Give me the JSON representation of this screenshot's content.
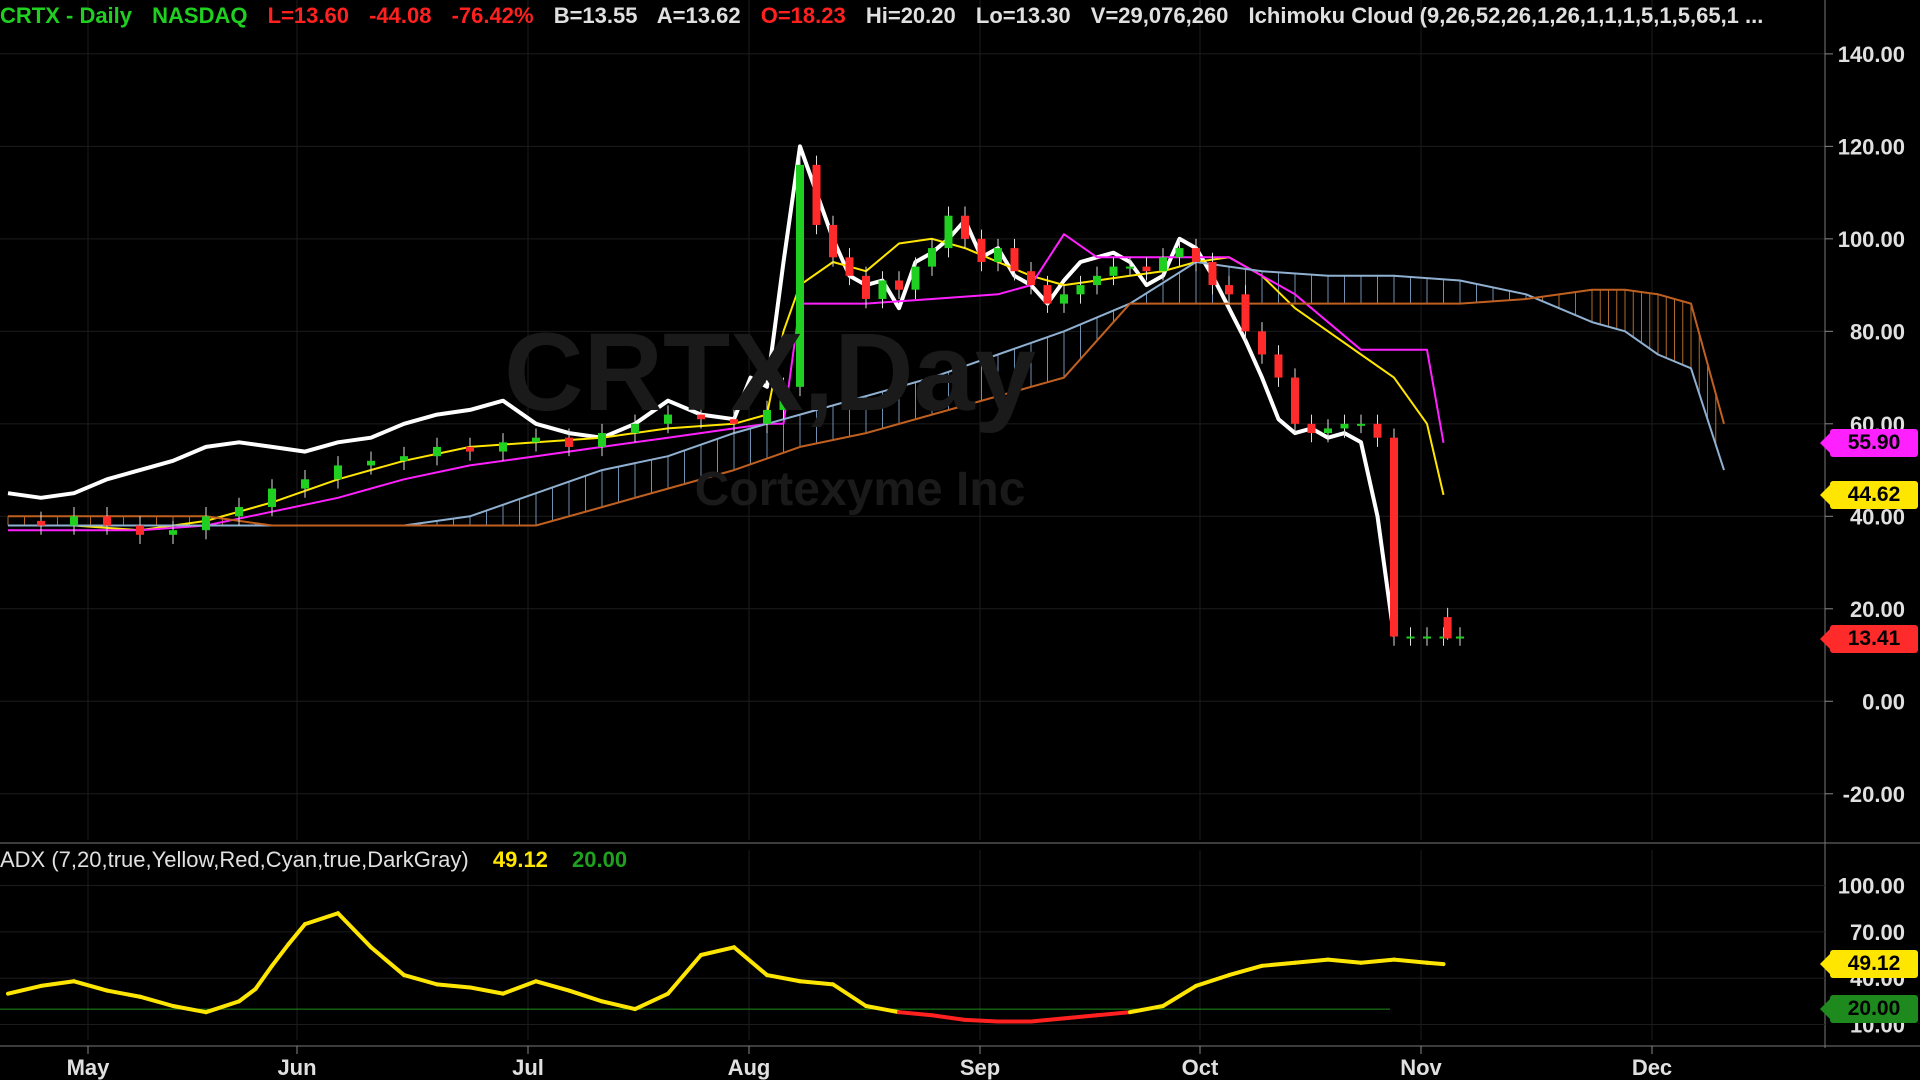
{
  "header": {
    "symbol": "CRTX - Daily",
    "exchange": "NASDAQ",
    "last": "L=13.60",
    "change": "-44.08",
    "change_pct": "-76.42%",
    "bid": "B=13.55",
    "ask": "A=13.62",
    "open": "O=18.23",
    "high": "Hi=20.20",
    "low": "Lo=13.30",
    "volume": "V=29,076,260",
    "study": "Ichimoku Cloud (9,26,52,26,1,26,1,1,1,5,1,5,65,1 ..."
  },
  "watermark": {
    "symbol": "CRTX,Day",
    "company": "Cortexyme Inc"
  },
  "adx_header": {
    "label": "ADX (7,20,true,Yellow,Red,Cyan,true,DarkGray)",
    "value": "49.12",
    "threshold": "20.00"
  },
  "price_tags": [
    {
      "value": "55.90",
      "color": "#ff20ff",
      "text_color": "#000"
    },
    {
      "value": "44.62",
      "color": "#ffe600",
      "text_color": "#000"
    },
    {
      "value": "13.41",
      "color": "#ff2a2a",
      "text_color": "#000"
    }
  ],
  "adx_tags": [
    {
      "value": "49.12",
      "color": "#ffe600",
      "text_color": "#000"
    },
    {
      "value": "20.00",
      "color": "#1e8a1e",
      "text_color": "#000"
    }
  ],
  "chart_data": [
    {
      "type": "line",
      "title": "CRTX - Daily",
      "x_labels": [
        "May",
        "Jun",
        "Jul",
        "Aug",
        "Sep",
        "Oct",
        "Nov",
        "Dec"
      ],
      "y_ticks": [
        "140.00",
        "120.00",
        "100.00",
        "80.00",
        "60.00",
        "40.00",
        "20.00",
        "0.00",
        "-20.00"
      ],
      "ylim": [
        -30,
        143
      ],
      "series": [
        {
          "name": "lagging",
          "color": "#ffffff",
          "x": [
            0,
            4,
            8,
            12,
            16,
            20,
            24,
            28,
            32,
            36,
            40,
            44,
            48,
            52,
            56,
            60,
            64,
            68,
            72,
            76,
            80,
            84,
            88,
            90,
            92,
            94,
            96,
            98,
            100,
            102,
            104,
            106,
            108,
            110,
            112,
            114,
            116,
            118,
            120,
            122,
            124,
            126,
            128,
            130,
            132,
            134,
            136,
            138,
            140,
            142,
            144,
            146,
            148,
            150,
            152,
            154,
            156,
            158,
            160,
            162,
            164,
            166,
            168,
            170,
            172,
            174,
            176
          ],
          "y": [
            45,
            44,
            45,
            48,
            50,
            52,
            55,
            56,
            55,
            54,
            56,
            57,
            60,
            62,
            63,
            65,
            60,
            58,
            57,
            60,
            65,
            62,
            61,
            70,
            68,
            95,
            120,
            110,
            100,
            92,
            90,
            91,
            85,
            95,
            97,
            100,
            104,
            96,
            98,
            92,
            90,
            86,
            91,
            95,
            96,
            97,
            95,
            90,
            92,
            100,
            98,
            92,
            85,
            78,
            70,
            61,
            58,
            59,
            57,
            58,
            56,
            40,
            14,
            null,
            null,
            null,
            null
          ]
        },
        {
          "name": "price-close",
          "color": "#20d020",
          "x": [
            0,
            4,
            8,
            12,
            16,
            20,
            24,
            28,
            32,
            36,
            40,
            44,
            48,
            52,
            56,
            60,
            64,
            68,
            72,
            76,
            80,
            84,
            88,
            92,
            94,
            96,
            98,
            100,
            102,
            104,
            106,
            108,
            110,
            112,
            114,
            116,
            118,
            120,
            122,
            124,
            126,
            128,
            130,
            132,
            134,
            136,
            138,
            140,
            142,
            144,
            146,
            148,
            150,
            152,
            154,
            156,
            158,
            160,
            162,
            164,
            166,
            168,
            170,
            172,
            174,
            176
          ],
          "y": [
            39,
            38,
            40,
            38,
            36,
            37,
            40,
            42,
            46,
            48,
            51,
            52,
            53,
            55,
            54,
            56,
            57,
            55,
            58,
            60,
            62,
            61,
            60,
            63,
            68,
            116,
            103,
            96,
            92,
            87,
            91,
            89,
            94,
            98,
            105,
            100,
            95,
            98,
            93,
            90,
            86,
            88,
            90,
            92,
            94,
            94,
            93,
            96,
            98,
            95,
            90,
            88,
            80,
            75,
            70,
            60,
            58,
            59,
            60,
            60,
            57,
            14,
            14,
            14,
            14,
            14
          ]
        },
        {
          "name": "tenkan",
          "color": "#ffe600",
          "x": [
            0,
            8,
            16,
            24,
            32,
            40,
            48,
            56,
            64,
            72,
            80,
            88,
            92,
            94,
            96,
            100,
            104,
            108,
            112,
            116,
            120,
            124,
            128,
            132,
            136,
            140,
            144,
            148,
            152,
            156,
            160,
            164,
            168,
            172,
            174
          ],
          "y": [
            38,
            38,
            37,
            39,
            43,
            48,
            52,
            55,
            56,
            57,
            59,
            60,
            62,
            80,
            90,
            95,
            93,
            99,
            100,
            98,
            95,
            92,
            90,
            91,
            92,
            93,
            95,
            96,
            92,
            85,
            80,
            75,
            70,
            60,
            44.62
          ]
        },
        {
          "name": "kijun",
          "color": "#ff20ff",
          "x": [
            0,
            16,
            24,
            32,
            40,
            48,
            56,
            64,
            72,
            80,
            88,
            92,
            94,
            96,
            104,
            112,
            120,
            124,
            128,
            132,
            140,
            148,
            156,
            164,
            168,
            172,
            174
          ],
          "y": [
            37,
            37,
            38,
            41,
            44,
            48,
            51,
            53,
            55,
            57,
            59,
            60,
            60,
            86,
            86,
            87,
            88,
            90,
            101,
            96,
            96,
            96,
            88,
            76,
            76,
            76,
            55.9
          ]
        },
        {
          "name": "senkou-a",
          "color": "#8fb0d0",
          "x": [
            0,
            8,
            16,
            24,
            32,
            40,
            48,
            56,
            64,
            72,
            80,
            88,
            96,
            104,
            112,
            120,
            128,
            136,
            144,
            152,
            160,
            168,
            176,
            184,
            192,
            196,
            200,
            204,
            208
          ],
          "y": [
            38,
            38,
            38,
            38,
            38,
            38,
            38,
            40,
            45,
            50,
            53,
            58,
            62,
            66,
            70,
            75,
            80,
            86,
            95,
            93,
            92,
            92,
            91,
            88,
            82,
            80,
            75,
            72,
            50
          ]
        },
        {
          "name": "senkou-b",
          "color": "#c06020",
          "x": [
            0,
            8,
            16,
            24,
            32,
            40,
            48,
            56,
            64,
            72,
            80,
            88,
            96,
            104,
            112,
            120,
            128,
            136,
            144,
            152,
            160,
            168,
            176,
            184,
            192,
            196,
            200,
            204,
            208
          ],
          "y": [
            40,
            40,
            40,
            40,
            38,
            38,
            38,
            38,
            38,
            42,
            46,
            50,
            55,
            58,
            62,
            66,
            70,
            86,
            86,
            86,
            86,
            86,
            86,
            87,
            89,
            89,
            88,
            86,
            60
          ]
        },
        {
          "name": "adx",
          "color": "#ffe600",
          "x": [
            0,
            4,
            8,
            12,
            16,
            20,
            24,
            28,
            30,
            32,
            34,
            36,
            40,
            44,
            48,
            52,
            56,
            60,
            64,
            68,
            72,
            76,
            80,
            84,
            88,
            92,
            96,
            100,
            104,
            108,
            112,
            116,
            120,
            124,
            128,
            132,
            136,
            140,
            144,
            148,
            152,
            156,
            160,
            164,
            168,
            172,
            174
          ],
          "y": [
            30,
            35,
            38,
            32,
            28,
            22,
            18,
            25,
            33,
            48,
            62,
            75,
            82,
            60,
            42,
            36,
            34,
            30,
            38,
            32,
            25,
            20,
            30,
            55,
            60,
            42,
            38,
            36,
            22,
            18,
            16,
            13,
            12,
            12,
            14,
            16,
            18,
            22,
            35,
            42,
            48,
            50,
            52,
            50,
            52,
            50,
            49.12
          ]
        }
      ]
    },
    {
      "type": "line",
      "title": "ADX (7,20,true,Yellow,Red,Cyan,true,DarkGray)",
      "y_ticks": [
        "100.00",
        "70.00",
        "40.00",
        "10.00"
      ],
      "ylim": [
        0,
        110
      ],
      "threshold": 20
    }
  ]
}
